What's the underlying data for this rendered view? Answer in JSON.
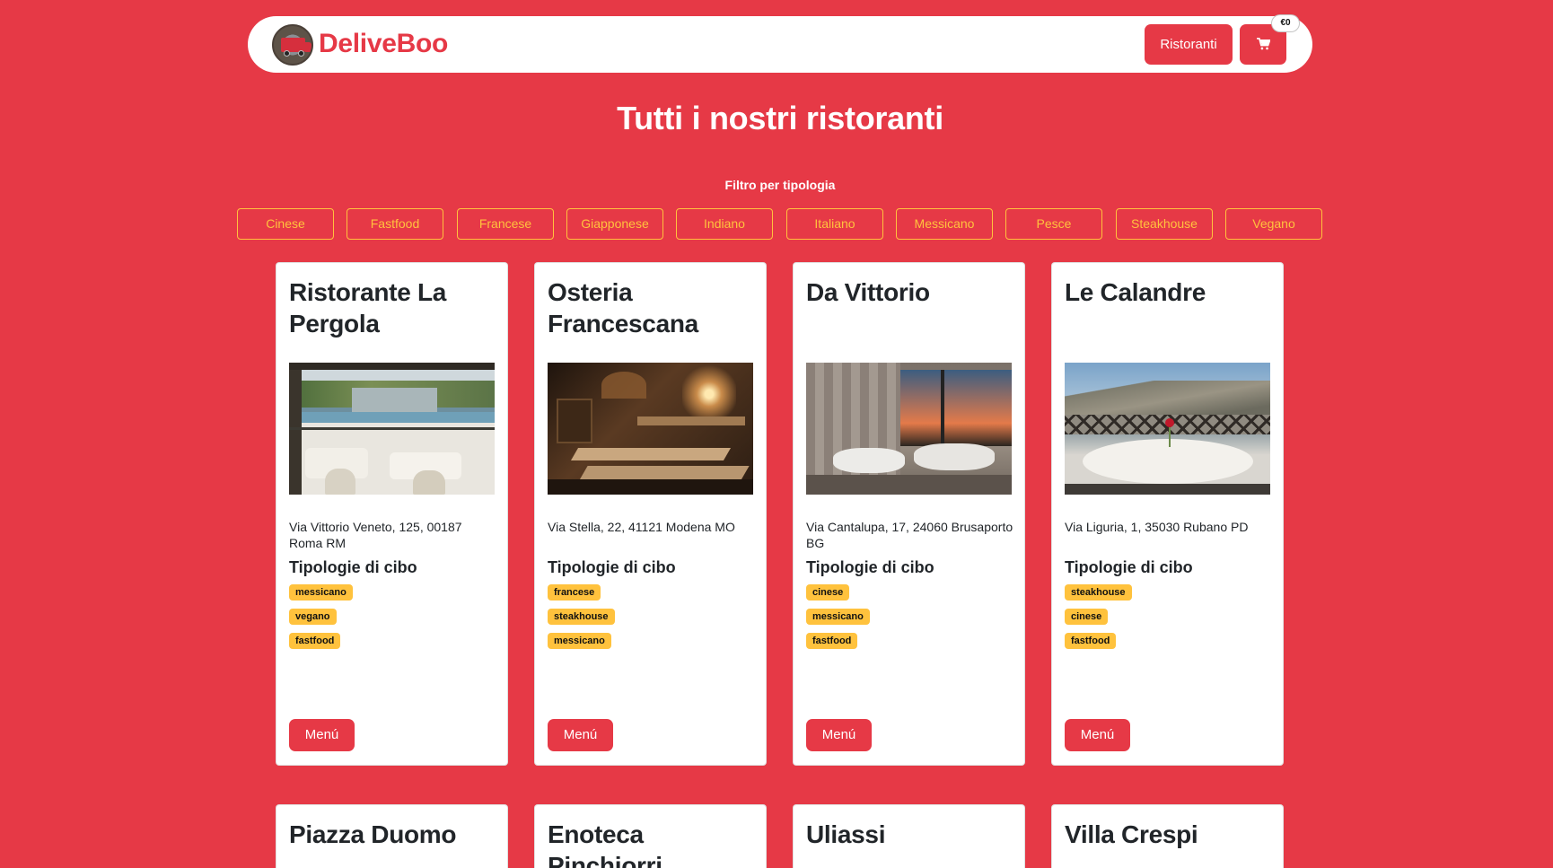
{
  "nav": {
    "brand": "DeliveBoo",
    "ristoranti_label": "Ristoranti",
    "cart_icon": "cart-icon",
    "cart_badge": "€0"
  },
  "page": {
    "title": "Tutti i nostri ristoranti"
  },
  "filter": {
    "label": "Filtro per tipologia",
    "options": [
      "Cinese",
      "Fastfood",
      "Francese",
      "Giapponese",
      "Indiano",
      "Italiano",
      "Messicano",
      "Pesce",
      "Steakhouse",
      "Vegano"
    ]
  },
  "restaurants": [
    {
      "name": "Ristorante La Pergola",
      "address": "Via Vittorio Veneto, 125, 00187 Roma RM",
      "types_title": "Tipologie di cibo",
      "types": [
        "messicano",
        "vegano",
        "fastfood"
      ],
      "menu_label": "Menú"
    },
    {
      "name": "Osteria Francescana",
      "address": "Via Stella, 22, 41121 Modena MO",
      "types_title": "Tipologie di cibo",
      "types": [
        "francese",
        "steakhouse",
        "messicano"
      ],
      "menu_label": "Menú"
    },
    {
      "name": "Da Vittorio",
      "address": "Via Cantalupa, 17, 24060 Brusaporto BG",
      "types_title": "Tipologie di cibo",
      "types": [
        "cinese",
        "messicano",
        "fastfood"
      ],
      "menu_label": "Menú"
    },
    {
      "name": "Le Calandre",
      "address": "Via Liguria, 1, 35030 Rubano PD",
      "types_title": "Tipologie di cibo",
      "types": [
        "steakhouse",
        "cinese",
        "fastfood"
      ],
      "menu_label": "Menú"
    },
    {
      "name": "Piazza Duomo"
    },
    {
      "name": "Enoteca Pinchiorri"
    },
    {
      "name": "Uliassi"
    },
    {
      "name": "Villa Crespi"
    }
  ]
}
